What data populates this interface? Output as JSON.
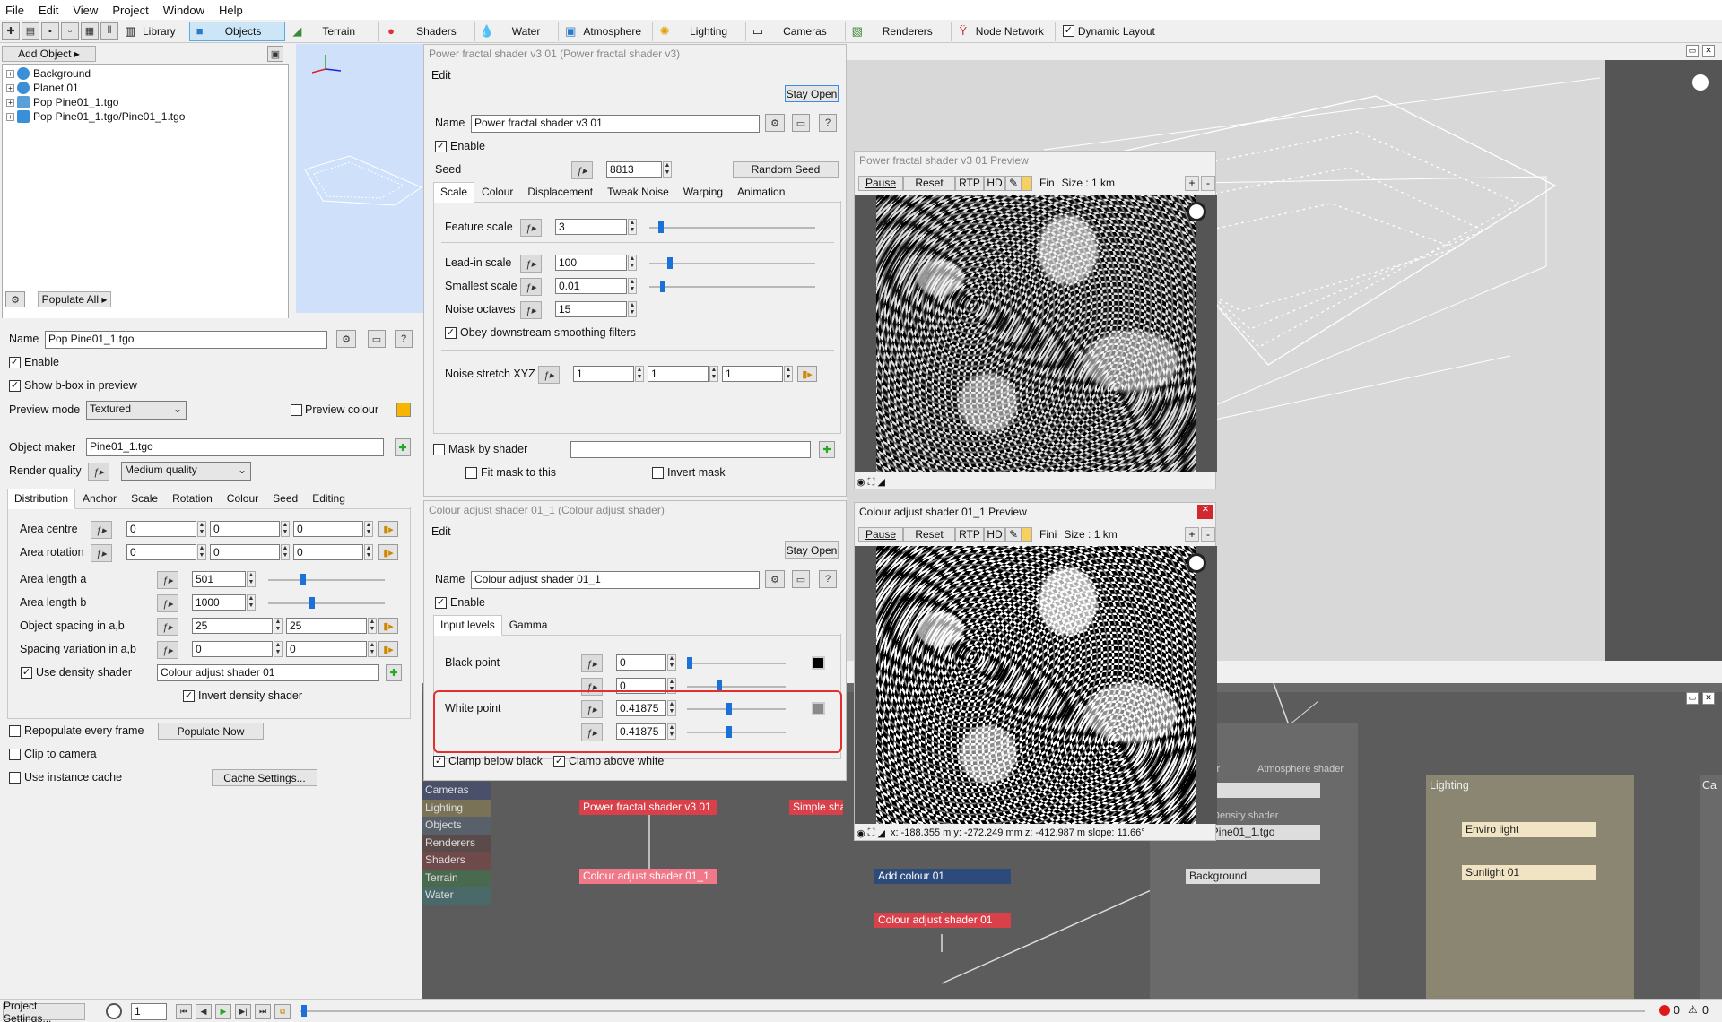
{
  "menu": [
    "File",
    "Edit",
    "View",
    "Project",
    "Window",
    "Help"
  ],
  "toolbar": {
    "tabs": [
      "Library",
      "Objects",
      "Terrain",
      "Shaders",
      "Water",
      "Atmosphere",
      "Lighting",
      "Cameras",
      "Renderers",
      "Node Network"
    ],
    "dynamic_layout": "Dynamic Layout"
  },
  "objects": {
    "add_object": "Add Object",
    "tree": [
      "Background",
      "Planet 01",
      "Pop Pine01_1.tgo",
      "Pop Pine01_1.tgo/Pine01_1.tgo"
    ],
    "populate_all": "Populate All"
  },
  "pop": {
    "name_label": "Name",
    "name": "Pop Pine01_1.tgo",
    "enable": "Enable",
    "show_bbox": "Show b-box in preview",
    "preview_mode_label": "Preview mode",
    "preview_mode": "Textured",
    "preview_colour": "Preview colour",
    "object_maker_label": "Object maker",
    "object_maker": "Pine01_1.tgo",
    "render_quality_label": "Render quality",
    "render_quality": "Medium quality",
    "tabs": [
      "Distribution",
      "Anchor",
      "Scale",
      "Rotation",
      "Colour",
      "Seed",
      "Editing"
    ],
    "area_centre": "Area centre",
    "area_rotation": "Area rotation",
    "area_length_a": "Area length a",
    "area_length_b": "Area length b",
    "object_spacing": "Object spacing in a,b",
    "spacing_variation": "Spacing variation in a,b",
    "use_density": "Use density shader",
    "density_shader": "Colour adjust shader 01",
    "invert_density": "Invert density shader",
    "v_zero": "0",
    "v_len_a": "501",
    "v_len_b": "1000",
    "v_spacing": "25",
    "repopulate": "Repopulate every frame",
    "populate_now": "Populate Now",
    "clip": "Clip to camera",
    "instance_cache": "Use instance cache",
    "cache_settings": "Cache Settings...",
    "project_settings": "Project Settings..."
  },
  "pfs": {
    "title": "Power fractal shader v3 01   (Power fractal shader v3)",
    "edit": "Edit",
    "stay_open": "Stay Open",
    "name_label": "Name",
    "name": "Power fractal shader v3 01",
    "enable": "Enable",
    "seed_label": "Seed",
    "seed": "8813",
    "random_seed": "Random Seed",
    "tabs": [
      "Scale",
      "Colour",
      "Displacement",
      "Tweak Noise",
      "Warping",
      "Animation"
    ],
    "feature_scale": "Feature scale",
    "feature_scale_v": "3",
    "lead_in": "Lead-in scale",
    "lead_in_v": "100",
    "smallest": "Smallest scale",
    "smallest_v": "0.01",
    "octaves": "Noise octaves",
    "octaves_v": "15",
    "obey": "Obey downstream smoothing filters",
    "stretch": "Noise stretch XYZ",
    "stretch_v": "1",
    "mask": "Mask by shader",
    "fit_mask": "Fit mask to this",
    "invert_mask": "Invert mask"
  },
  "cas": {
    "title": "Colour adjust shader 01_1   (Colour adjust shader)",
    "edit": "Edit",
    "stay_open": "Stay Open",
    "name_label": "Name",
    "name": "Colour adjust shader 01_1",
    "enable": "Enable",
    "tabs": [
      "Input levels",
      "Gamma"
    ],
    "black_point": "Black point",
    "black_v": "0",
    "white_point": "White point",
    "white_v": "0.41875",
    "clamp_below": "Clamp below black",
    "clamp_above": "Clamp above white"
  },
  "preview1": {
    "title": "Power fractal shader v3 01 Preview",
    "pause": "Pause",
    "reset": "Reset",
    "rtp": "RTP",
    "hd": "HD",
    "fin": "Fin",
    "size": "Size : 1 km"
  },
  "preview2": {
    "title": "Colour adjust shader 01_1 Preview",
    "pause": "Pause",
    "reset": "Reset",
    "rtp": "RTP",
    "hd": "HD",
    "fin": "Fini",
    "size": "Size : 1 km",
    "coords": "x: -188.355 m    y: -272.249 mm  z: -412.987 m      slope: 11.66°"
  },
  "nodes": {
    "list": [
      "Cameras",
      "Lighting",
      "Objects",
      "Renderers",
      "Shaders",
      "Terrain",
      "Water"
    ],
    "pfs_node": "Power fractal shader v3 01",
    "simple_node": "Simple shape",
    "cas_node": "Colour adjust shader 01_1",
    "add_colour": "Add colour 01",
    "cas2_node": "Colour adjust shader 01",
    "shader_lbl": "hader",
    "atmo_lbl": "Atmosphere shader",
    "n01": "01",
    "density_lbl": "Density shader",
    "pop_node": "Pop Pine01_1.tgo",
    "bg_node": "Background",
    "lighting": "Lighting",
    "enviro": "Enviro light",
    "sunlight": "Sunlight 01",
    "ca": "Ca"
  },
  "timeline": {
    "frame": "1",
    "errors": "0",
    "warnings": "0"
  }
}
